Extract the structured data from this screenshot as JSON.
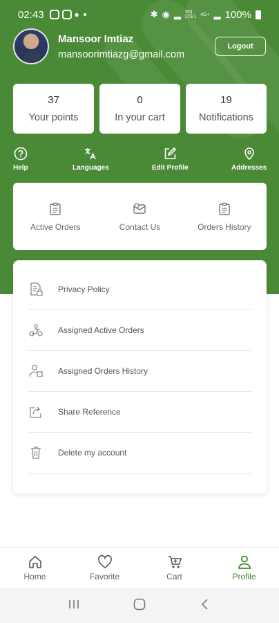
{
  "status_bar": {
    "time": "02:43",
    "battery": "100%",
    "net_top": "Vo)",
    "net_bottom": "LTE1",
    "net2_top": "4G+",
    "net2_bottom": ""
  },
  "profile": {
    "name": "Mansoor Imtiaz",
    "email": "mansoorimtiazg@gmail.com",
    "logout_label": "Logout"
  },
  "stats": [
    {
      "value": "37",
      "label": "Your points"
    },
    {
      "value": "0",
      "label": "In your cart"
    },
    {
      "value": "19",
      "label": "Notifications"
    }
  ],
  "quick_actions": [
    {
      "label": "Help",
      "icon": "help-circle-icon"
    },
    {
      "label": "Languages",
      "icon": "translate-icon"
    },
    {
      "label": "Edit Profile",
      "icon": "edit-icon"
    },
    {
      "label": "Addresses",
      "icon": "location-pin-icon"
    }
  ],
  "orders_card": [
    {
      "label": "Active Orders",
      "icon": "clipboard-icon"
    },
    {
      "label": "Contact Us",
      "icon": "contact-icon"
    },
    {
      "label": "Orders History",
      "icon": "clipboard-icon"
    }
  ],
  "menu": [
    {
      "label": "Privacy Policy",
      "icon": "document-lock-icon"
    },
    {
      "label": "Assigned Active Orders",
      "icon": "delivery-scooter-icon"
    },
    {
      "label": "Assigned Orders History",
      "icon": "delivery-person-icon"
    },
    {
      "label": "Share Reference",
      "icon": "share-icon"
    },
    {
      "label": "Delete my account",
      "icon": "trash-icon"
    }
  ],
  "bottom_nav": [
    {
      "label": "Home",
      "icon": "home-icon",
      "active": false
    },
    {
      "label": "Favorite",
      "icon": "heart-icon",
      "active": false
    },
    {
      "label": "Cart",
      "icon": "cart-icon",
      "active": false
    },
    {
      "label": "Profile",
      "icon": "person-icon",
      "active": true
    }
  ],
  "colors": {
    "primary": "#4a8a36",
    "active_nav": "#3f8a2d"
  }
}
